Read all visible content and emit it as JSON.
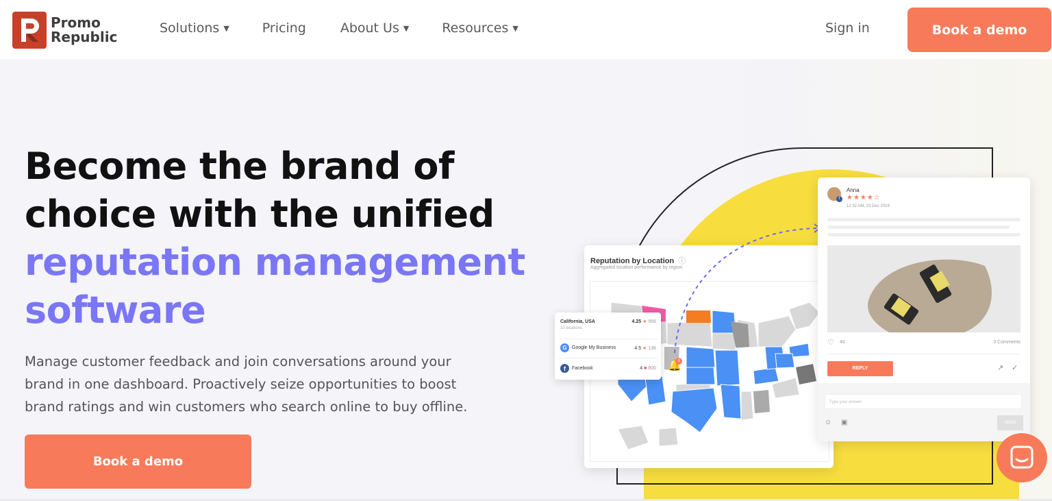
{
  "brand": {
    "line1": "Promo",
    "line2": "Republic",
    "accent_color": "#c7402a"
  },
  "nav": {
    "items": [
      {
        "label": "Solutions",
        "has_dropdown": true
      },
      {
        "label": "Pricing",
        "has_dropdown": false
      },
      {
        "label": "About Us",
        "has_dropdown": true
      },
      {
        "label": "Resources",
        "has_dropdown": true
      }
    ],
    "sign_in": "Sign in",
    "cta": "Book a demo"
  },
  "hero": {
    "headline_line1": "Become the brand of",
    "headline_line2": "choice with the unified",
    "headline_accent1": "reputation management",
    "headline_accent2": "software",
    "desc_line1": "Manage customer feedback and join conversations around your",
    "desc_line2": "brand in one dashboard. Proactively seize opportunities to boost",
    "desc_line3": "brand ratings and win customers who search online to buy offline.",
    "cta": "Book a demo",
    "accent_color": "#7a76f5",
    "button_color": "#f77b5a"
  },
  "map_card": {
    "title": "Reputation by Location",
    "subtitle": "Aggregated location performance by region",
    "bell_count": "3"
  },
  "location_card": {
    "location": "California, USA",
    "location_sub": "10 locations",
    "location_rating": "4.25",
    "location_count": "956",
    "rows": [
      {
        "name": "Google My Business",
        "rating": "4.5",
        "count": "136"
      },
      {
        "name": "Facebook",
        "rating": "4",
        "count": "800"
      }
    ]
  },
  "review_card": {
    "author": "Anna",
    "stars_filled": 4,
    "stars_total": 5,
    "time": "12:32 AM, 23 Dec 2019",
    "likes": "46",
    "comments": "3 Comments",
    "reply": "REPLY",
    "placeholder": "Type your answer",
    "send": "SEND"
  }
}
